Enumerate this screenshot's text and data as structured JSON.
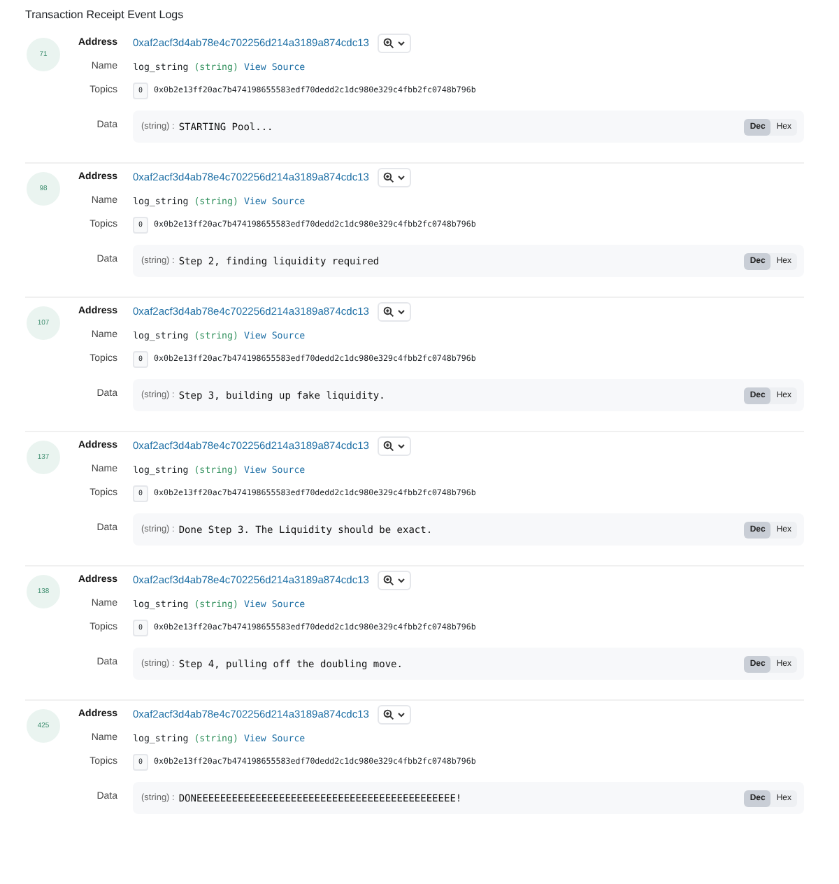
{
  "title": "Transaction Receipt Event Logs",
  "logs": [
    {
      "index": "71",
      "address": "0xaf2acf3d4ab78e4c702256d214a3189a874cdc13",
      "name": "log_string",
      "type": "(string)",
      "source_link": "View Source",
      "topic_index": "0",
      "topic": "0x0b2e13ff20ac7b474198655583edf70dedd2c1dc980e329c4fbb2fc0748b796b",
      "data_type": "(string) :",
      "data_value": "STARTING Pool...",
      "labels": {
        "address": "Address",
        "name": "Name",
        "topics": "Topics",
        "data": "Data"
      },
      "formats": [
        {
          "label": "Dec",
          "selected": true
        },
        {
          "label": "Hex",
          "selected": false
        }
      ]
    },
    {
      "index": "98",
      "address": "0xaf2acf3d4ab78e4c702256d214a3189a874cdc13",
      "name": "log_string",
      "type": "(string)",
      "source_link": "View Source",
      "topic_index": "0",
      "topic": "0x0b2e13ff20ac7b474198655583edf70dedd2c1dc980e329c4fbb2fc0748b796b",
      "data_type": "(string) :",
      "data_value": "Step 2, finding liquidity required",
      "labels": {
        "address": "Address",
        "name": "Name",
        "topics": "Topics",
        "data": "Data"
      },
      "formats": [
        {
          "label": "Dec",
          "selected": true
        },
        {
          "label": "Hex",
          "selected": false
        }
      ]
    },
    {
      "index": "107",
      "address": "0xaf2acf3d4ab78e4c702256d214a3189a874cdc13",
      "name": "log_string",
      "type": "(string)",
      "source_link": "View Source",
      "topic_index": "0",
      "topic": "0x0b2e13ff20ac7b474198655583edf70dedd2c1dc980e329c4fbb2fc0748b796b",
      "data_type": "(string) :",
      "data_value": "Step 3, building up fake liquidity.",
      "labels": {
        "address": "Address",
        "name": "Name",
        "topics": "Topics",
        "data": "Data"
      },
      "formats": [
        {
          "label": "Dec",
          "selected": true
        },
        {
          "label": "Hex",
          "selected": false
        }
      ]
    },
    {
      "index": "137",
      "address": "0xaf2acf3d4ab78e4c702256d214a3189a874cdc13",
      "name": "log_string",
      "type": "(string)",
      "source_link": "View Source",
      "topic_index": "0",
      "topic": "0x0b2e13ff20ac7b474198655583edf70dedd2c1dc980e329c4fbb2fc0748b796b",
      "data_type": "(string) :",
      "data_value": "Done Step 3. The Liquidity should be exact.",
      "labels": {
        "address": "Address",
        "name": "Name",
        "topics": "Topics",
        "data": "Data"
      },
      "formats": [
        {
          "label": "Dec",
          "selected": true
        },
        {
          "label": "Hex",
          "selected": false
        }
      ]
    },
    {
      "index": "138",
      "address": "0xaf2acf3d4ab78e4c702256d214a3189a874cdc13",
      "name": "log_string",
      "type": "(string)",
      "source_link": "View Source",
      "topic_index": "0",
      "topic": "0x0b2e13ff20ac7b474198655583edf70dedd2c1dc980e329c4fbb2fc0748b796b",
      "data_type": "(string) :",
      "data_value": "Step 4, pulling off the doubling move.",
      "labels": {
        "address": "Address",
        "name": "Name",
        "topics": "Topics",
        "data": "Data"
      },
      "formats": [
        {
          "label": "Dec",
          "selected": true
        },
        {
          "label": "Hex",
          "selected": false
        }
      ]
    },
    {
      "index": "425",
      "address": "0xaf2acf3d4ab78e4c702256d214a3189a874cdc13",
      "name": "log_string",
      "type": "(string)",
      "source_link": "View Source",
      "topic_index": "0",
      "topic": "0x0b2e13ff20ac7b474198655583edf70dedd2c1dc980e329c4fbb2fc0748b796b",
      "data_type": "(string) :",
      "data_value": "DONEEEEEEEEEEEEEEEEEEEEEEEEEEEEEEEEEEEEEEEEEEEE!",
      "labels": {
        "address": "Address",
        "name": "Name",
        "topics": "Topics",
        "data": "Data"
      },
      "formats": [
        {
          "label": "Dec",
          "selected": true
        },
        {
          "label": "Hex",
          "selected": false
        }
      ]
    }
  ]
}
